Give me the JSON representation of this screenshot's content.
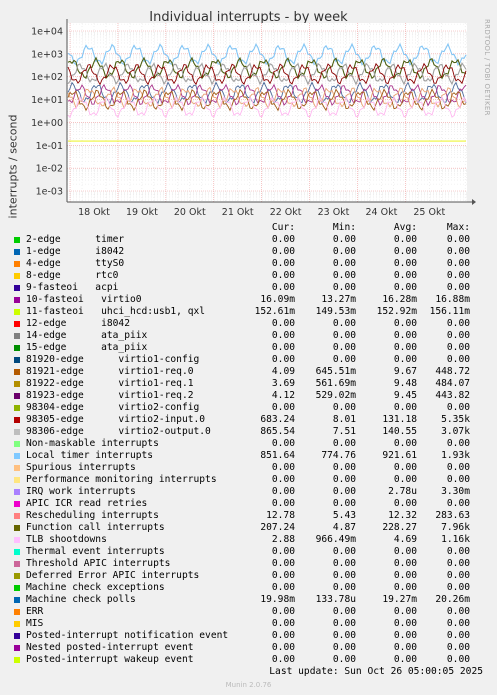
{
  "chart_data": {
    "type": "line",
    "title": "Individual interrupts - by week",
    "ylabel": "interrupts / second",
    "yscale": "log",
    "ylim": [
      0.0005,
      20000
    ],
    "yticks": [
      "1e+04",
      "1e+03",
      "1e+02",
      "1e+01",
      "1e+00",
      "1e-01",
      "1e-02",
      "1e-03"
    ],
    "xticks": [
      "18 Okt",
      "19 Okt",
      "20 Okt",
      "21 Okt",
      "22 Okt",
      "23 Okt",
      "24 Okt",
      "25 Okt"
    ],
    "grid": true,
    "series_levels": [
      {
        "name": "Local timer interrupts",
        "level": 921.61,
        "color": "#82c5f5"
      },
      {
        "name": "Function call interrupts",
        "level": 228.27,
        "color": "#4c5e10"
      },
      {
        "name": "virtio2-output.0",
        "level": 140.55,
        "color": "#a0a0a0"
      },
      {
        "name": "virtio2-input.0",
        "level": 131.18,
        "color": "#8a0000"
      },
      {
        "name": "Machine check polls",
        "level": 19.27,
        "color": "#4c6b9a"
      },
      {
        "name": "virtio0",
        "level": 16.28,
        "color": "#a8328a"
      },
      {
        "name": "Rescheduling interrupts",
        "level": 12.32,
        "color": "#e8a070"
      },
      {
        "name": "virtio1-req.0",
        "level": 9.67,
        "color": "#a05a14"
      },
      {
        "name": "TLB shootdowns",
        "level": 4.69,
        "color": "#ffb8f0"
      },
      {
        "name": "uhci_hcd:usb1, qxl",
        "level": 0.153,
        "color": "#e8f000"
      },
      {
        "name": "IRQ work interrupts",
        "level": 2.7e-06,
        "color": "#b09aeb"
      }
    ]
  },
  "legend": {
    "headers": {
      "cur": "Cur:",
      "min": "Min:",
      "avg": "Avg:",
      "max": "Max:"
    },
    "rows": [
      {
        "name": "2-edge      timer",
        "color": "#00cc00",
        "cur": "0.00",
        "min": "0.00",
        "avg": "0.00",
        "max": "0.00"
      },
      {
        "name": "1-edge      i8042",
        "color": "#0066b3",
        "cur": "0.00",
        "min": "0.00",
        "avg": "0.00",
        "max": "0.00"
      },
      {
        "name": "4-edge      ttyS0",
        "color": "#ff8000",
        "cur": "0.00",
        "min": "0.00",
        "avg": "0.00",
        "max": "0.00"
      },
      {
        "name": "8-edge      rtc0",
        "color": "#ffcc00",
        "cur": "0.00",
        "min": "0.00",
        "avg": "0.00",
        "max": "0.00"
      },
      {
        "name": "9-fasteoi   acpi",
        "color": "#330099",
        "cur": "0.00",
        "min": "0.00",
        "avg": "0.00",
        "max": "0.00"
      },
      {
        "name": "10-fasteoi   virtio0",
        "color": "#990099",
        "cur": "16.09m",
        "min": "13.27m",
        "avg": "16.28m",
        "max": "16.88m"
      },
      {
        "name": "11-fasteoi   uhci_hcd:usb1, qxl",
        "color": "#ccff00",
        "cur": "152.61m",
        "min": "149.53m",
        "avg": "152.92m",
        "max": "156.11m"
      },
      {
        "name": "12-edge      i8042",
        "color": "#ff0000",
        "cur": "0.00",
        "min": "0.00",
        "avg": "0.00",
        "max": "0.00"
      },
      {
        "name": "14-edge      ata_piix",
        "color": "#808080",
        "cur": "0.00",
        "min": "0.00",
        "avg": "0.00",
        "max": "0.00"
      },
      {
        "name": "15-edge      ata_piix",
        "color": "#008f00",
        "cur": "0.00",
        "min": "0.00",
        "avg": "0.00",
        "max": "0.00"
      },
      {
        "name": "81920-edge      virtio1-config",
        "color": "#00487d",
        "cur": "0.00",
        "min": "0.00",
        "avg": "0.00",
        "max": "0.00"
      },
      {
        "name": "81921-edge      virtio1-req.0",
        "color": "#b35a00",
        "cur": "4.09",
        "min": "645.51m",
        "avg": "9.67",
        "max": "448.72"
      },
      {
        "name": "81922-edge      virtio1-req.1",
        "color": "#b38f00",
        "cur": "3.69",
        "min": "561.69m",
        "avg": "9.48",
        "max": "484.07"
      },
      {
        "name": "81923-edge      virtio1-req.2",
        "color": "#6b006b",
        "cur": "4.12",
        "min": "529.02m",
        "avg": "9.45",
        "max": "443.82"
      },
      {
        "name": "98304-edge      virtio2-config",
        "color": "#8fb300",
        "cur": "0.00",
        "min": "0.00",
        "avg": "0.00",
        "max": "0.00"
      },
      {
        "name": "98305-edge      virtio2-input.0",
        "color": "#b30000",
        "cur": "683.24",
        "min": "8.01",
        "avg": "131.18",
        "max": "5.35k"
      },
      {
        "name": "98306-edge      virtio2-output.0",
        "color": "#bebebe",
        "cur": "865.54",
        "min": "7.51",
        "avg": "140.55",
        "max": "3.07k"
      },
      {
        "name": "Non-maskable interrupts",
        "color": "#80ff80",
        "cur": "0.00",
        "min": "0.00",
        "avg": "0.00",
        "max": "0.00"
      },
      {
        "name": "Local timer interrupts",
        "color": "#80c9ff",
        "cur": "851.64",
        "min": "774.76",
        "avg": "921.61",
        "max": "1.93k"
      },
      {
        "name": "Spurious interrupts",
        "color": "#ffc080",
        "cur": "0.00",
        "min": "0.00",
        "avg": "0.00",
        "max": "0.00"
      },
      {
        "name": "Performance monitoring interrupts",
        "color": "#ffe680",
        "cur": "0.00",
        "min": "0.00",
        "avg": "0.00",
        "max": "0.00"
      },
      {
        "name": "IRQ work interrupts",
        "color": "#aa80ff",
        "cur": "0.00",
        "min": "0.00",
        "avg": "2.78u",
        "max": "3.30m"
      },
      {
        "name": "APIC ICR read retries",
        "color": "#ee00cc",
        "cur": "0.00",
        "min": "0.00",
        "avg": "0.00",
        "max": "0.00"
      },
      {
        "name": "Rescheduling interrupts",
        "color": "#ff8080",
        "cur": "12.78",
        "min": "5.43",
        "avg": "12.32",
        "max": "283.63"
      },
      {
        "name": "Function call interrupts",
        "color": "#666600",
        "cur": "207.24",
        "min": "4.87",
        "avg": "228.27",
        "max": "7.96k"
      },
      {
        "name": "TLB shootdowns",
        "color": "#ffbfff",
        "cur": "2.88",
        "min": "966.49m",
        "avg": "4.69",
        "max": "1.16k"
      },
      {
        "name": "Thermal event interrupts",
        "color": "#00ffcc",
        "cur": "0.00",
        "min": "0.00",
        "avg": "0.00",
        "max": "0.00"
      },
      {
        "name": "Threshold APIC interrupts",
        "color": "#cc6699",
        "cur": "0.00",
        "min": "0.00",
        "avg": "0.00",
        "max": "0.00"
      },
      {
        "name": "Deferred Error APIC interrupts",
        "color": "#999900",
        "cur": "0.00",
        "min": "0.00",
        "avg": "0.00",
        "max": "0.00"
      },
      {
        "name": "Machine check exceptions",
        "color": "#00cc00",
        "cur": "0.00",
        "min": "0.00",
        "avg": "0.00",
        "max": "0.00"
      },
      {
        "name": "Machine check polls",
        "color": "#0066b3",
        "cur": "19.98m",
        "min": "133.78u",
        "avg": "19.27m",
        "max": "20.26m"
      },
      {
        "name": "ERR",
        "color": "#ff8000",
        "cur": "0.00",
        "min": "0.00",
        "avg": "0.00",
        "max": "0.00"
      },
      {
        "name": "MIS",
        "color": "#ffcc00",
        "cur": "0.00",
        "min": "0.00",
        "avg": "0.00",
        "max": "0.00"
      },
      {
        "name": "Posted-interrupt notification event",
        "color": "#330099",
        "cur": "0.00",
        "min": "0.00",
        "avg": "0.00",
        "max": "0.00"
      },
      {
        "name": "Nested posted-interrupt event",
        "color": "#990099",
        "cur": "0.00",
        "min": "0.00",
        "avg": "0.00",
        "max": "0.00"
      },
      {
        "name": "Posted-interrupt wakeup event",
        "color": "#ccff00",
        "cur": "0.00",
        "min": "0.00",
        "avg": "0.00",
        "max": "0.00"
      }
    ]
  },
  "last_update": "Last update: Sun Oct 26 05:00:05 2025",
  "watermark": "RRDTOOL / TOBI OETIKER",
  "footer": "Munin 2.0.76"
}
